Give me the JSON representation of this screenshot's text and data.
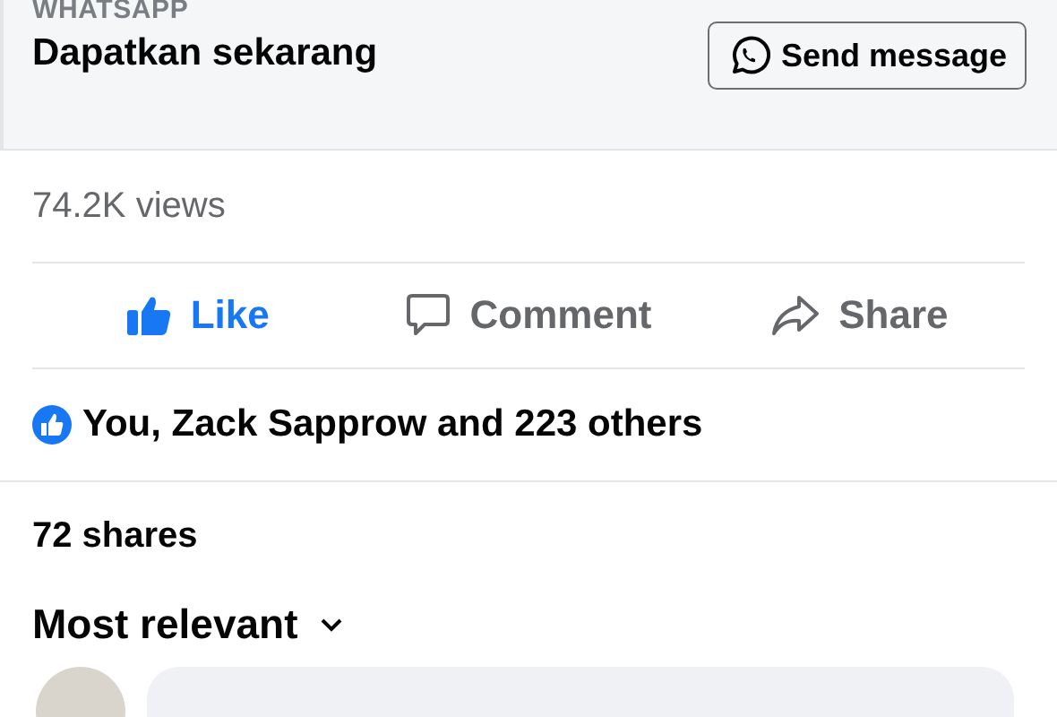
{
  "ad": {
    "source": "WHATSAPP",
    "title": "Dapatkan sekarang",
    "button": "Send message"
  },
  "views": "74.2K views",
  "actions": [
    {
      "kind": "like",
      "label": "Like",
      "selected": true
    },
    {
      "kind": "comment",
      "label": "Comment",
      "selected": false
    },
    {
      "kind": "share",
      "label": "Share",
      "selected": false
    }
  ],
  "reactions": "You, Zack Sapprow and 223 others",
  "shares": "72 shares",
  "sort": {
    "label": "Most relevant"
  }
}
